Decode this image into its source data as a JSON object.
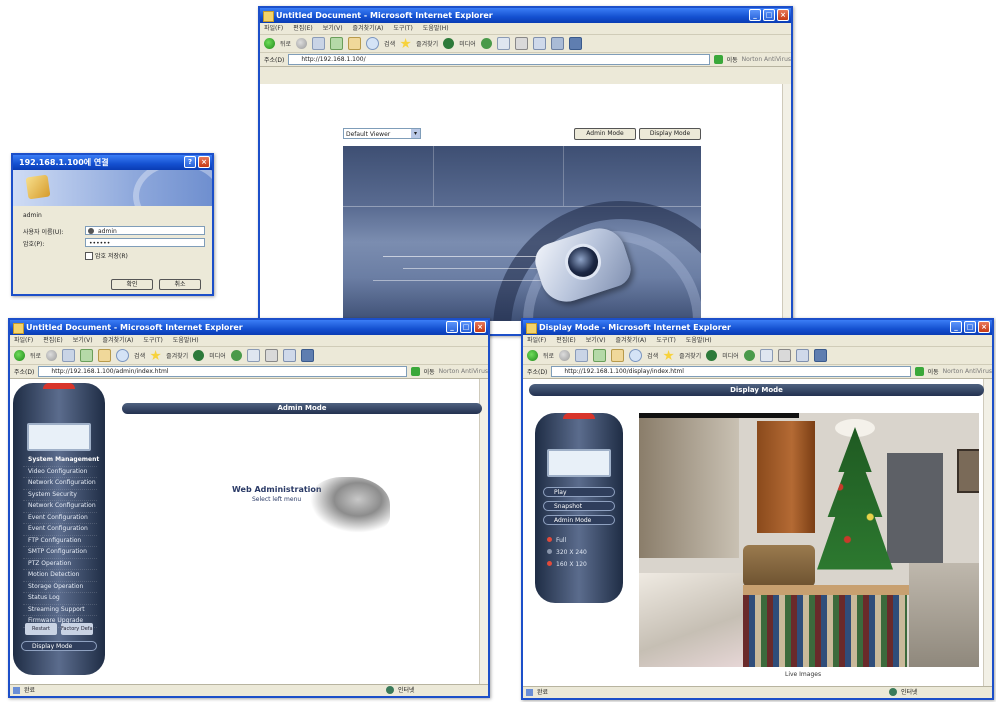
{
  "login_dialog": {
    "title": "192.168.1.100에 연결",
    "label_site": "admin",
    "label_user": "사용자 이름(U):",
    "label_pass": "암호(P):",
    "user_value": "admin",
    "pass_value": "••••••",
    "remember_label": "암호 저장(R)",
    "ok_label": "확인",
    "cancel_label": "취소"
  },
  "main_window": {
    "title": "Untitled Document - Microsoft Internet Explorer",
    "menu": [
      "파일(F)",
      "편집(E)",
      "보기(V)",
      "즐겨찾기(A)",
      "도구(T)",
      "도움말(H)"
    ],
    "toolbar": {
      "back": "뒤로",
      "search": "검색",
      "favorites": "즐겨찾기",
      "media": "미디어"
    },
    "address_label": "주소(D)",
    "address": "http://192.168.1.100/",
    "go_label": "이동",
    "links_label": "Norton AntiVirus",
    "viewer_select": "Default Viewer",
    "admin_button": "Admin Mode",
    "display_button": "Display Mode"
  },
  "admin_window": {
    "title": "Untitled Document - Microsoft Internet Explorer",
    "menu": [
      "파일(F)",
      "편집(E)",
      "보기(V)",
      "즐겨찾기(A)",
      "도구(T)",
      "도움말(H)"
    ],
    "toolbar": {
      "back": "뒤로",
      "search": "검색",
      "favorites": "즐겨찾기",
      "media": "미디어"
    },
    "address_label": "주소(D)",
    "address": "http://192.168.1.100/admin/index.html",
    "go_label": "이동",
    "links_label": "Norton AntiVirus",
    "header": "Admin Mode",
    "nav_items": [
      "System Management",
      "Video Configuration",
      "Network Configuration",
      "System Security",
      "Network Configuration",
      "Event Configuration",
      "Event Configuration",
      "FTP Configuration",
      "SMTP Configuration",
      "PTZ Operation",
      "Motion Detection",
      "Storage Operation",
      "Status Log",
      "Streaming Support",
      "Firmware Upgrade"
    ],
    "bottom_buttons": [
      "Restart",
      "Factory Default"
    ],
    "display_mode_button": "Display Mode",
    "welcome_title": "Web Administration",
    "welcome_sub": "Select left menu",
    "status": "완료",
    "zone": "인터넷"
  },
  "display_window": {
    "title": "Display Mode - Microsoft Internet Explorer",
    "menu": [
      "파일(F)",
      "편집(E)",
      "보기(V)",
      "즐겨찾기(A)",
      "도구(T)",
      "도움말(H)"
    ],
    "toolbar": {
      "back": "뒤로",
      "search": "검색",
      "favorites": "즐겨찾기",
      "media": "미디어"
    },
    "address_label": "주소(D)",
    "address": "http://192.168.1.100/display/index.html",
    "go_label": "이동",
    "links_label": "Norton AntiVirus",
    "header": "Display Mode",
    "side_buttons": [
      "Play",
      "Snapshot",
      "Admin Mode"
    ],
    "resolutions": [
      "Full",
      "320 X 240",
      "160 X 120"
    ],
    "caption": "Live Images",
    "status": "완료",
    "zone": "인터넷"
  },
  "colors": {
    "xp_title": "#1450d0",
    "device_body": "#2b3a57",
    "accent_red": "#d8352b"
  }
}
